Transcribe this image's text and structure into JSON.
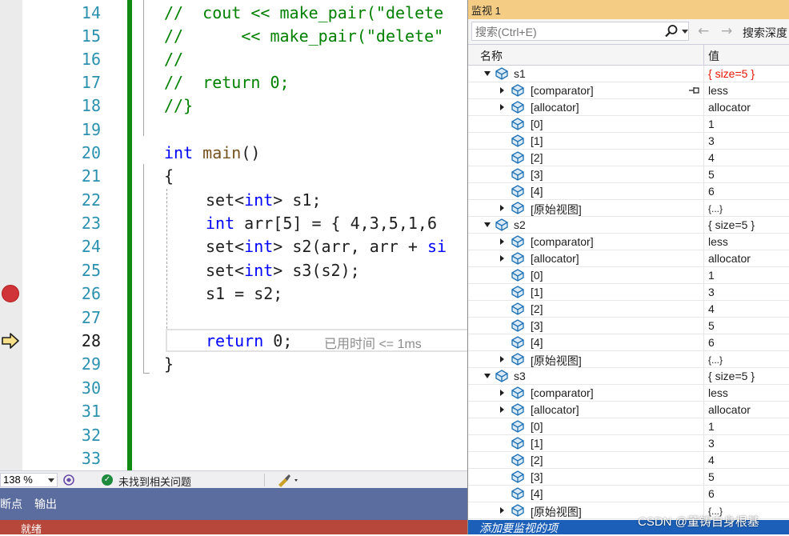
{
  "editor": {
    "line_numbers": [
      "14",
      "15",
      "16",
      "17",
      "18",
      "19",
      "20",
      "21",
      "22",
      "23",
      "24",
      "25",
      "26",
      "27",
      "28",
      "29",
      "30",
      "31",
      "32",
      "33"
    ],
    "current_line": "28",
    "breakpoint_line": "26",
    "elapsed_text": "已用时间 <= 1ms",
    "code": {
      "l14_cm": "//  cout << make_pair(\"delete",
      "l15_cm": "//      << make_pair(\"delete\"",
      "l16_cm": "//",
      "l17_cm": "//  return 0;",
      "l18_cm": "//}",
      "l20_kw": "int",
      "l20_fn": "main",
      "l20_rest": "()",
      "l21": "{",
      "l22_a": "set<",
      "l22_kw": "int",
      "l22_b": "> s1;",
      "l23_kw": "int",
      "l23_rest": " arr[5] = { 4,3,5,1,6",
      "l24_a": "set<",
      "l24_kw": "int",
      "l24_b": "> s2(arr, arr + ",
      "l24_si": "si",
      "l25_a": "set<",
      "l25_kw": "int",
      "l25_b": "> s3(s2);",
      "l26": "s1 = s2;",
      "l28_kw": "return",
      "l28_rest": " 0;",
      "l29": "}"
    }
  },
  "editor_status": {
    "zoom": "138 %",
    "issues": "未找到相关问题"
  },
  "tool_tabs": [
    "断点",
    "输出"
  ],
  "status_bar": {
    "text": "就绪"
  },
  "watch": {
    "title": "监视 1",
    "search_placeholder": "搜索(Ctrl+E)",
    "search_depth_label": "搜索深度",
    "col_name": "名称",
    "col_value": "值",
    "rows": [
      {
        "name": "s1",
        "value": "{ size=5 }"
      },
      {
        "name": "[comparator]",
        "value": "less"
      },
      {
        "name": "[allocator]",
        "value": "allocator"
      },
      {
        "name": "[0]",
        "value": "1"
      },
      {
        "name": "[1]",
        "value": "3"
      },
      {
        "name": "[2]",
        "value": "4"
      },
      {
        "name": "[3]",
        "value": "5"
      },
      {
        "name": "[4]",
        "value": "6"
      },
      {
        "name": "[原始视图]",
        "value": "{...}"
      },
      {
        "name": "s2",
        "value": "{ size=5 }"
      },
      {
        "name": "[comparator]",
        "value": "less"
      },
      {
        "name": "[allocator]",
        "value": "allocator"
      },
      {
        "name": "[0]",
        "value": "1"
      },
      {
        "name": "[1]",
        "value": "3"
      },
      {
        "name": "[2]",
        "value": "4"
      },
      {
        "name": "[3]",
        "value": "5"
      },
      {
        "name": "[4]",
        "value": "6"
      },
      {
        "name": "[原始视图]",
        "value": "{...}"
      },
      {
        "name": "s3",
        "value": "{ size=5 }"
      },
      {
        "name": "[comparator]",
        "value": "less"
      },
      {
        "name": "[allocator]",
        "value": "allocator"
      },
      {
        "name": "[0]",
        "value": "1"
      },
      {
        "name": "[1]",
        "value": "3"
      },
      {
        "name": "[2]",
        "value": "4"
      },
      {
        "name": "[3]",
        "value": "5"
      },
      {
        "name": "[4]",
        "value": "6"
      },
      {
        "name": "[原始视图]",
        "value": "{...}"
      }
    ],
    "add_item": "添加要监视的项"
  },
  "watermark": "CSDN @董铸自身根基",
  "colors": {
    "changed_value": "#e51400",
    "status_bar": "#b7473a",
    "tool_tabs": "#5b6c9e",
    "watch_title": "#f5cc84"
  }
}
